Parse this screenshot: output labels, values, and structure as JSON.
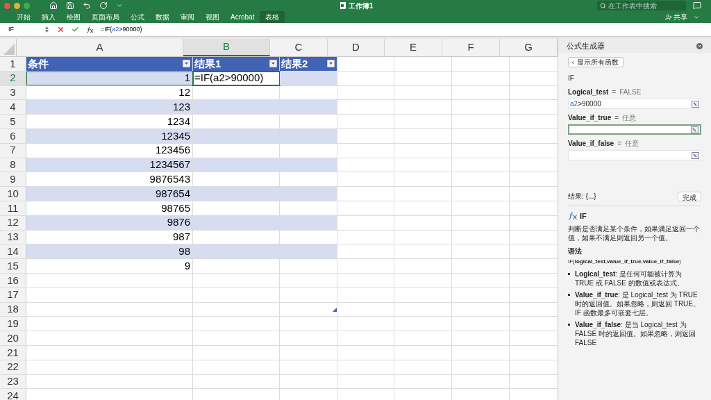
{
  "title_bar": {
    "title": "工作簿1",
    "search_placeholder": "在工作表中搜索"
  },
  "ribbon": {
    "tabs": [
      {
        "label": "开始",
        "selected": false
      },
      {
        "label": "插入",
        "selected": false
      },
      {
        "label": "绘图",
        "selected": false
      },
      {
        "label": "页面布局",
        "selected": false
      },
      {
        "label": "公式",
        "selected": false
      },
      {
        "label": "数据",
        "selected": false
      },
      {
        "label": "审阅",
        "selected": false
      },
      {
        "label": "视图",
        "selected": false
      },
      {
        "label": "Acrobat",
        "selected": false
      },
      {
        "label": "表格",
        "selected": true
      }
    ],
    "share": "共享"
  },
  "formula_bar": {
    "name_box": "IF",
    "formula": [
      {
        "text": "=IF(",
        "kind": "plain"
      },
      {
        "text": "a2",
        "kind": "ref"
      },
      {
        "text": ">90000)",
        "kind": "plain"
      }
    ]
  },
  "sheet": {
    "columns": [
      {
        "label": "A",
        "selected": false
      },
      {
        "label": "B",
        "selected": true
      },
      {
        "label": "C",
        "selected": false
      },
      {
        "label": "D",
        "selected": false
      },
      {
        "label": "E",
        "selected": false
      },
      {
        "label": "F",
        "selected": false
      },
      {
        "label": "G",
        "selected": false
      }
    ],
    "table_header": [
      "条件",
      "结果1",
      "结果2"
    ],
    "rows": [
      {
        "number": "1",
        "selected": false
      },
      {
        "number": "2",
        "selected": true,
        "a": "1",
        "b": "=IF(a2>90000)"
      },
      {
        "number": "3",
        "selected": false,
        "a": "12"
      },
      {
        "number": "4",
        "selected": false,
        "a": "123"
      },
      {
        "number": "5",
        "selected": false,
        "a": "1234"
      },
      {
        "number": "6",
        "selected": false,
        "a": "12345"
      },
      {
        "number": "7",
        "selected": false,
        "a": "123456"
      },
      {
        "number": "8",
        "selected": false,
        "a": "1234567"
      },
      {
        "number": "9",
        "selected": false,
        "a": "9876543"
      },
      {
        "number": "10",
        "selected": false,
        "a": "987654"
      },
      {
        "number": "11",
        "selected": false,
        "a": "98765"
      },
      {
        "number": "12",
        "selected": false,
        "a": "9876"
      },
      {
        "number": "13",
        "selected": false,
        "a": "987"
      },
      {
        "number": "14",
        "selected": false,
        "a": "98"
      },
      {
        "number": "15",
        "selected": false,
        "a": "9"
      },
      {
        "number": "16",
        "selected": false
      },
      {
        "number": "17",
        "selected": false
      },
      {
        "number": "18",
        "selected": false
      },
      {
        "number": "19",
        "selected": false
      },
      {
        "number": "20",
        "selected": false
      },
      {
        "number": "21",
        "selected": false
      },
      {
        "number": "22",
        "selected": false
      },
      {
        "number": "23",
        "selected": false
      },
      {
        "number": "24",
        "selected": false
      }
    ]
  },
  "formula_builder": {
    "title": "公式生成器",
    "back_button": "显示所有函数",
    "function": "IF",
    "arguments": [
      {
        "name": "Logical_test",
        "equals": "=",
        "result": "FALSE",
        "value": [
          {
            "text": "a2",
            "kind": "ref"
          },
          {
            "text": ">90000",
            "kind": "plain"
          }
        ],
        "focused": false
      },
      {
        "name": "Value_if_true",
        "equals": "=",
        "result": "任意",
        "focused": true
      },
      {
        "name": "Value_if_false",
        "equals": "=",
        "result": "任意",
        "focused": false
      }
    ],
    "result": "结果: {...}",
    "done_button": "完成",
    "help": {
      "name": "IF",
      "description": "判断是否满足某个条件，如果满足返回一个值，如果不满足则返回另一个值。",
      "syntax_heading": "语法",
      "syntax": "IF(**logical_test**,**value_if_true**,**value_if_false**)",
      "bullets": [
        "**Logical_test**: 是任何可能被计算为 TRUE 或 FALSE 的数值或表达式。",
        "**Value_if_true**: 是 Logical_test 为 TRUE 时的返回值。如果忽略，则返回 TRUE。IF 函数最多可嵌套七层。",
        "**Value_if_false**: 是当 Logical_test 为 FALSE 时的返回值。如果忽略，则返回 FALSE"
      ]
    }
  }
}
